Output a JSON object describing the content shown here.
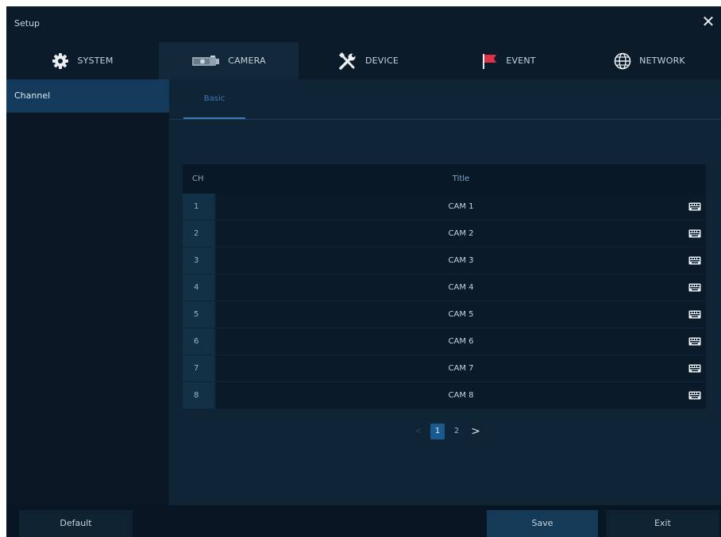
{
  "window": {
    "title": "Setup",
    "close_glyph": "✕"
  },
  "tabs": [
    {
      "label": "SYSTEM",
      "icon": "gear-icon",
      "active": false
    },
    {
      "label": "CAMERA",
      "icon": "camera-icon",
      "active": true
    },
    {
      "label": "DEVICE",
      "icon": "tools-icon",
      "active": false
    },
    {
      "label": "EVENT",
      "icon": "flag-icon",
      "active": false
    },
    {
      "label": "NETWORK",
      "icon": "globe-icon",
      "active": false
    }
  ],
  "sidebar": {
    "items": [
      {
        "label": "Channel",
        "selected": true
      }
    ]
  },
  "subtabs": [
    {
      "label": "Basic",
      "active": true
    }
  ],
  "table": {
    "headers": {
      "ch": "CH",
      "title": "Title"
    },
    "rows": [
      {
        "ch": "1",
        "title": "CAM 1"
      },
      {
        "ch": "2",
        "title": "CAM 2"
      },
      {
        "ch": "3",
        "title": "CAM 3"
      },
      {
        "ch": "4",
        "title": "CAM 4"
      },
      {
        "ch": "5",
        "title": "CAM 5"
      },
      {
        "ch": "6",
        "title": "CAM 6"
      },
      {
        "ch": "7",
        "title": "CAM 7"
      },
      {
        "ch": "8",
        "title": "CAM 8"
      }
    ],
    "row_action_icon": "keyboard-icon"
  },
  "pagination": {
    "prev": "<",
    "pages": [
      "1",
      "2"
    ],
    "current": "1",
    "next": ">"
  },
  "footer": {
    "default_label": "Default",
    "save_label": "Save",
    "exit_label": "Exit"
  },
  "colors": {
    "accent": "#3c79b8",
    "active_page": "#1b5a8f",
    "flag": "#e0304a"
  }
}
